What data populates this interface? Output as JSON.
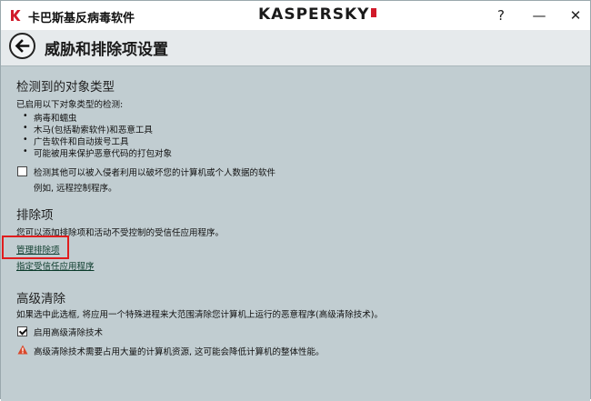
{
  "window": {
    "app_title": "卡巴斯基反病毒软件",
    "logo_text": "KASPERSKY",
    "help_label": "?",
    "minimize_label": "—",
    "close_label": "✕"
  },
  "header": {
    "title": "威胁和排除项设置"
  },
  "detected_objects": {
    "title": "检测到的对象类型",
    "intro": "已启用以下对象类型的检测:",
    "items": [
      "病毒和蠕虫",
      "木马(包括勒索软件)和恶意工具",
      "广告软件和自动拨号工具",
      "可能被用来保护恶意代码的打包对象"
    ],
    "checkbox_label": "检测其他可以被入侵者利用以破坏您的计算机或个人数据的软件",
    "checkbox_checked": false,
    "checkbox_note": "例如, 远程控制程序。"
  },
  "exclusions": {
    "title": "排除项",
    "description": "您可以添加排除项和活动不受控制的受信任应用程序。",
    "manage_link": "管理排除项",
    "trusted_link": "指定受信任应用程序"
  },
  "advanced": {
    "title": "高级清除",
    "description": "如果选中此选框, 将应用一个特殊进程来大范围清除您计算机上运行的恶意程序(高级清除技术)。",
    "checkbox_label": "启用高级清除技术",
    "checkbox_checked": true,
    "warning": "高级清除技术需要占用大量的计算机资源, 这可能会降低计算机的整体性能。"
  },
  "colors": {
    "background": "#c1cdd1",
    "highlight": "#e01d1d",
    "brand": "#d11a2a",
    "warning": "#d9482b"
  }
}
